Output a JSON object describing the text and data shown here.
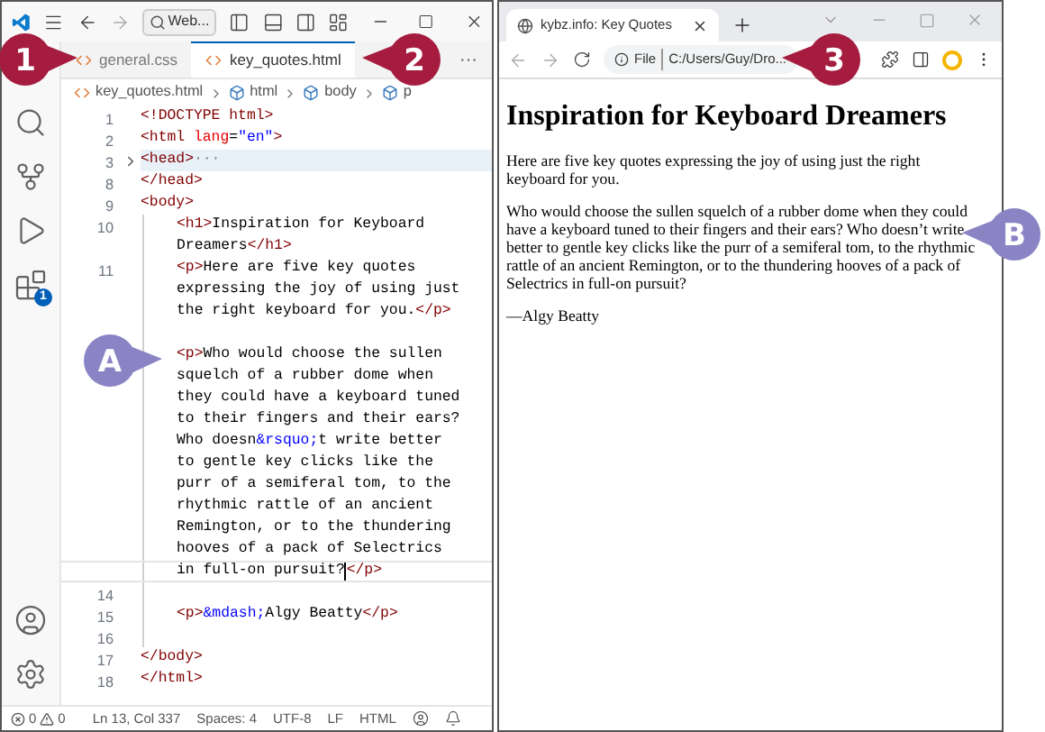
{
  "editor": {
    "title_bar": {
      "search": "Web..."
    },
    "tabs": [
      {
        "label": "general.css",
        "selected": false
      },
      {
        "label": "key_quotes.html",
        "selected": true
      }
    ],
    "more": "···",
    "breadcrumbs": [
      "key_quotes.html",
      "html",
      "body",
      "p"
    ],
    "badge": "1",
    "rows": [
      {
        "number": "1",
        "segments": [
          {
            "kind": "tag",
            "text": "<!DOCTYPE html>"
          }
        ]
      },
      {
        "number": "2",
        "segments": [
          {
            "kind": "tag",
            "text": "<html "
          },
          {
            "kind": "attr",
            "text": "lang"
          },
          {
            "kind": "text",
            "text": "="
          },
          {
            "kind": "string",
            "text": "\"en\""
          },
          {
            "kind": "tag",
            "text": ">"
          }
        ]
      },
      {
        "number": "3",
        "folded": true,
        "segments": [
          {
            "kind": "tag",
            "text": "<head>"
          },
          {
            "kind": "fold",
            "text": "···"
          }
        ]
      },
      {
        "number": "8",
        "segments": [
          {
            "kind": "tag",
            "text": "</head>"
          }
        ]
      },
      {
        "number": "9",
        "segments": [
          {
            "kind": "tag",
            "text": "<body>"
          }
        ]
      },
      {
        "number": "10",
        "indented": true,
        "segments": [
          {
            "kind": "tag",
            "text": "<h1>"
          },
          {
            "kind": "text",
            "text": "Inspiration for Keyboard"
          }
        ]
      },
      {
        "indented": true,
        "segments": [
          {
            "kind": "text",
            "text": "Dreamers"
          },
          {
            "kind": "tag",
            "text": "</h1>"
          }
        ]
      },
      {
        "number": "11",
        "indented": true,
        "segments": [
          {
            "kind": "tag",
            "text": "<p>"
          },
          {
            "kind": "text",
            "text": "Here are five key quotes"
          }
        ]
      },
      {
        "indented": true,
        "segments": [
          {
            "kind": "text",
            "text": "expressing the joy of using just"
          }
        ]
      },
      {
        "indented": true,
        "segments": [
          {
            "kind": "text",
            "text": "the right keyboard for you."
          },
          {
            "kind": "tag",
            "text": "</p>"
          }
        ]
      },
      {
        "indented": true
      },
      {
        "indented": true,
        "segments": [
          {
            "kind": "tag",
            "text": "<p>"
          },
          {
            "kind": "text",
            "text": "Who would choose the sullen"
          }
        ]
      },
      {
        "indented": true,
        "segments": [
          {
            "kind": "text",
            "text": "squelch of a rubber dome when"
          }
        ]
      },
      {
        "indented": true,
        "segments": [
          {
            "kind": "text",
            "text": "they could have a keyboard tuned"
          }
        ]
      },
      {
        "indented": true,
        "segments": [
          {
            "kind": "text",
            "text": "to their fingers and their ears?"
          }
        ]
      },
      {
        "indented": true,
        "segments": [
          {
            "kind": "text",
            "text": "Who doesn"
          },
          {
            "kind": "entity",
            "text": "&rsquo;"
          },
          {
            "kind": "text",
            "text": "t write better"
          }
        ]
      },
      {
        "indented": true,
        "segments": [
          {
            "kind": "text",
            "text": "to gentle key clicks like the"
          }
        ]
      },
      {
        "indented": true,
        "segments": [
          {
            "kind": "text",
            "text": "purr of a semiferal tom, to the"
          }
        ]
      },
      {
        "indented": true,
        "segments": [
          {
            "kind": "text",
            "text": "rhythmic rattle of an ancient"
          }
        ]
      },
      {
        "indented": true,
        "segments": [
          {
            "kind": "text",
            "text": "Remington, or to the thundering"
          }
        ]
      },
      {
        "indented": true,
        "segments": [
          {
            "kind": "text",
            "text": "hooves of a pack of Selectrics"
          }
        ]
      },
      {
        "indented": true,
        "current": true,
        "segments": [
          {
            "kind": "text",
            "text": "in full-on pursuit?"
          },
          {
            "kind": "cursor"
          },
          {
            "kind": "tag",
            "text": "</p>"
          }
        ]
      },
      {
        "number": "14",
        "indented": true
      },
      {
        "number": "15",
        "indented": true,
        "segments": [
          {
            "kind": "tag",
            "text": "<p>"
          },
          {
            "kind": "entity",
            "text": "&mdash;"
          },
          {
            "kind": "text",
            "text": "Algy Beatty"
          },
          {
            "kind": "tag",
            "text": "</p>"
          }
        ]
      },
      {
        "number": "16",
        "indented": true
      },
      {
        "number": "17",
        "segments": [
          {
            "kind": "tag",
            "text": "</body>"
          }
        ]
      },
      {
        "number": "18",
        "segments": [
          {
            "kind": "tag",
            "text": "</html>"
          }
        ]
      }
    ],
    "status_bar": {
      "errors": "0",
      "warnings": "0",
      "items": [
        "Ln 13, Col 337",
        "Spaces: 4",
        "UTF-8",
        "LF",
        "HTML"
      ]
    }
  },
  "browser": {
    "tab": {
      "title": "kybz.info: Key Quotes"
    },
    "address": {
      "scheme": "File",
      "url": "C:/Users/Guy/Dro..."
    },
    "heading": "Inspiration for Keyboard Dreamers",
    "paragraphs": [
      "Here are five key quotes expressing the joy of using just the right keyboard for you.",
      "Who would choose the sullen squelch of a rubber dome when they could have a keyboard tuned to their fingers and their ears? Who doesn’t write better to gentle key clicks like the purr of a semiferal tom, to the rhythmic rattle of an ancient Remington, or to the thundering hooves of a pack of Selectrics in full-on pursuit?",
      "—Algy Beatty"
    ]
  },
  "callouts": [
    {
      "label": "1",
      "color": "#a51c3f",
      "kind": "rightward"
    },
    {
      "label": "2",
      "color": "#a51c3f",
      "kind": "leftward"
    },
    {
      "label": "3",
      "color": "#a51c3f",
      "kind": "leftward"
    },
    {
      "label": "A",
      "color": "#8a84c5",
      "kind": "rightward"
    },
    {
      "label": "B",
      "color": "#8a84c5",
      "kind": "leftward"
    }
  ]
}
